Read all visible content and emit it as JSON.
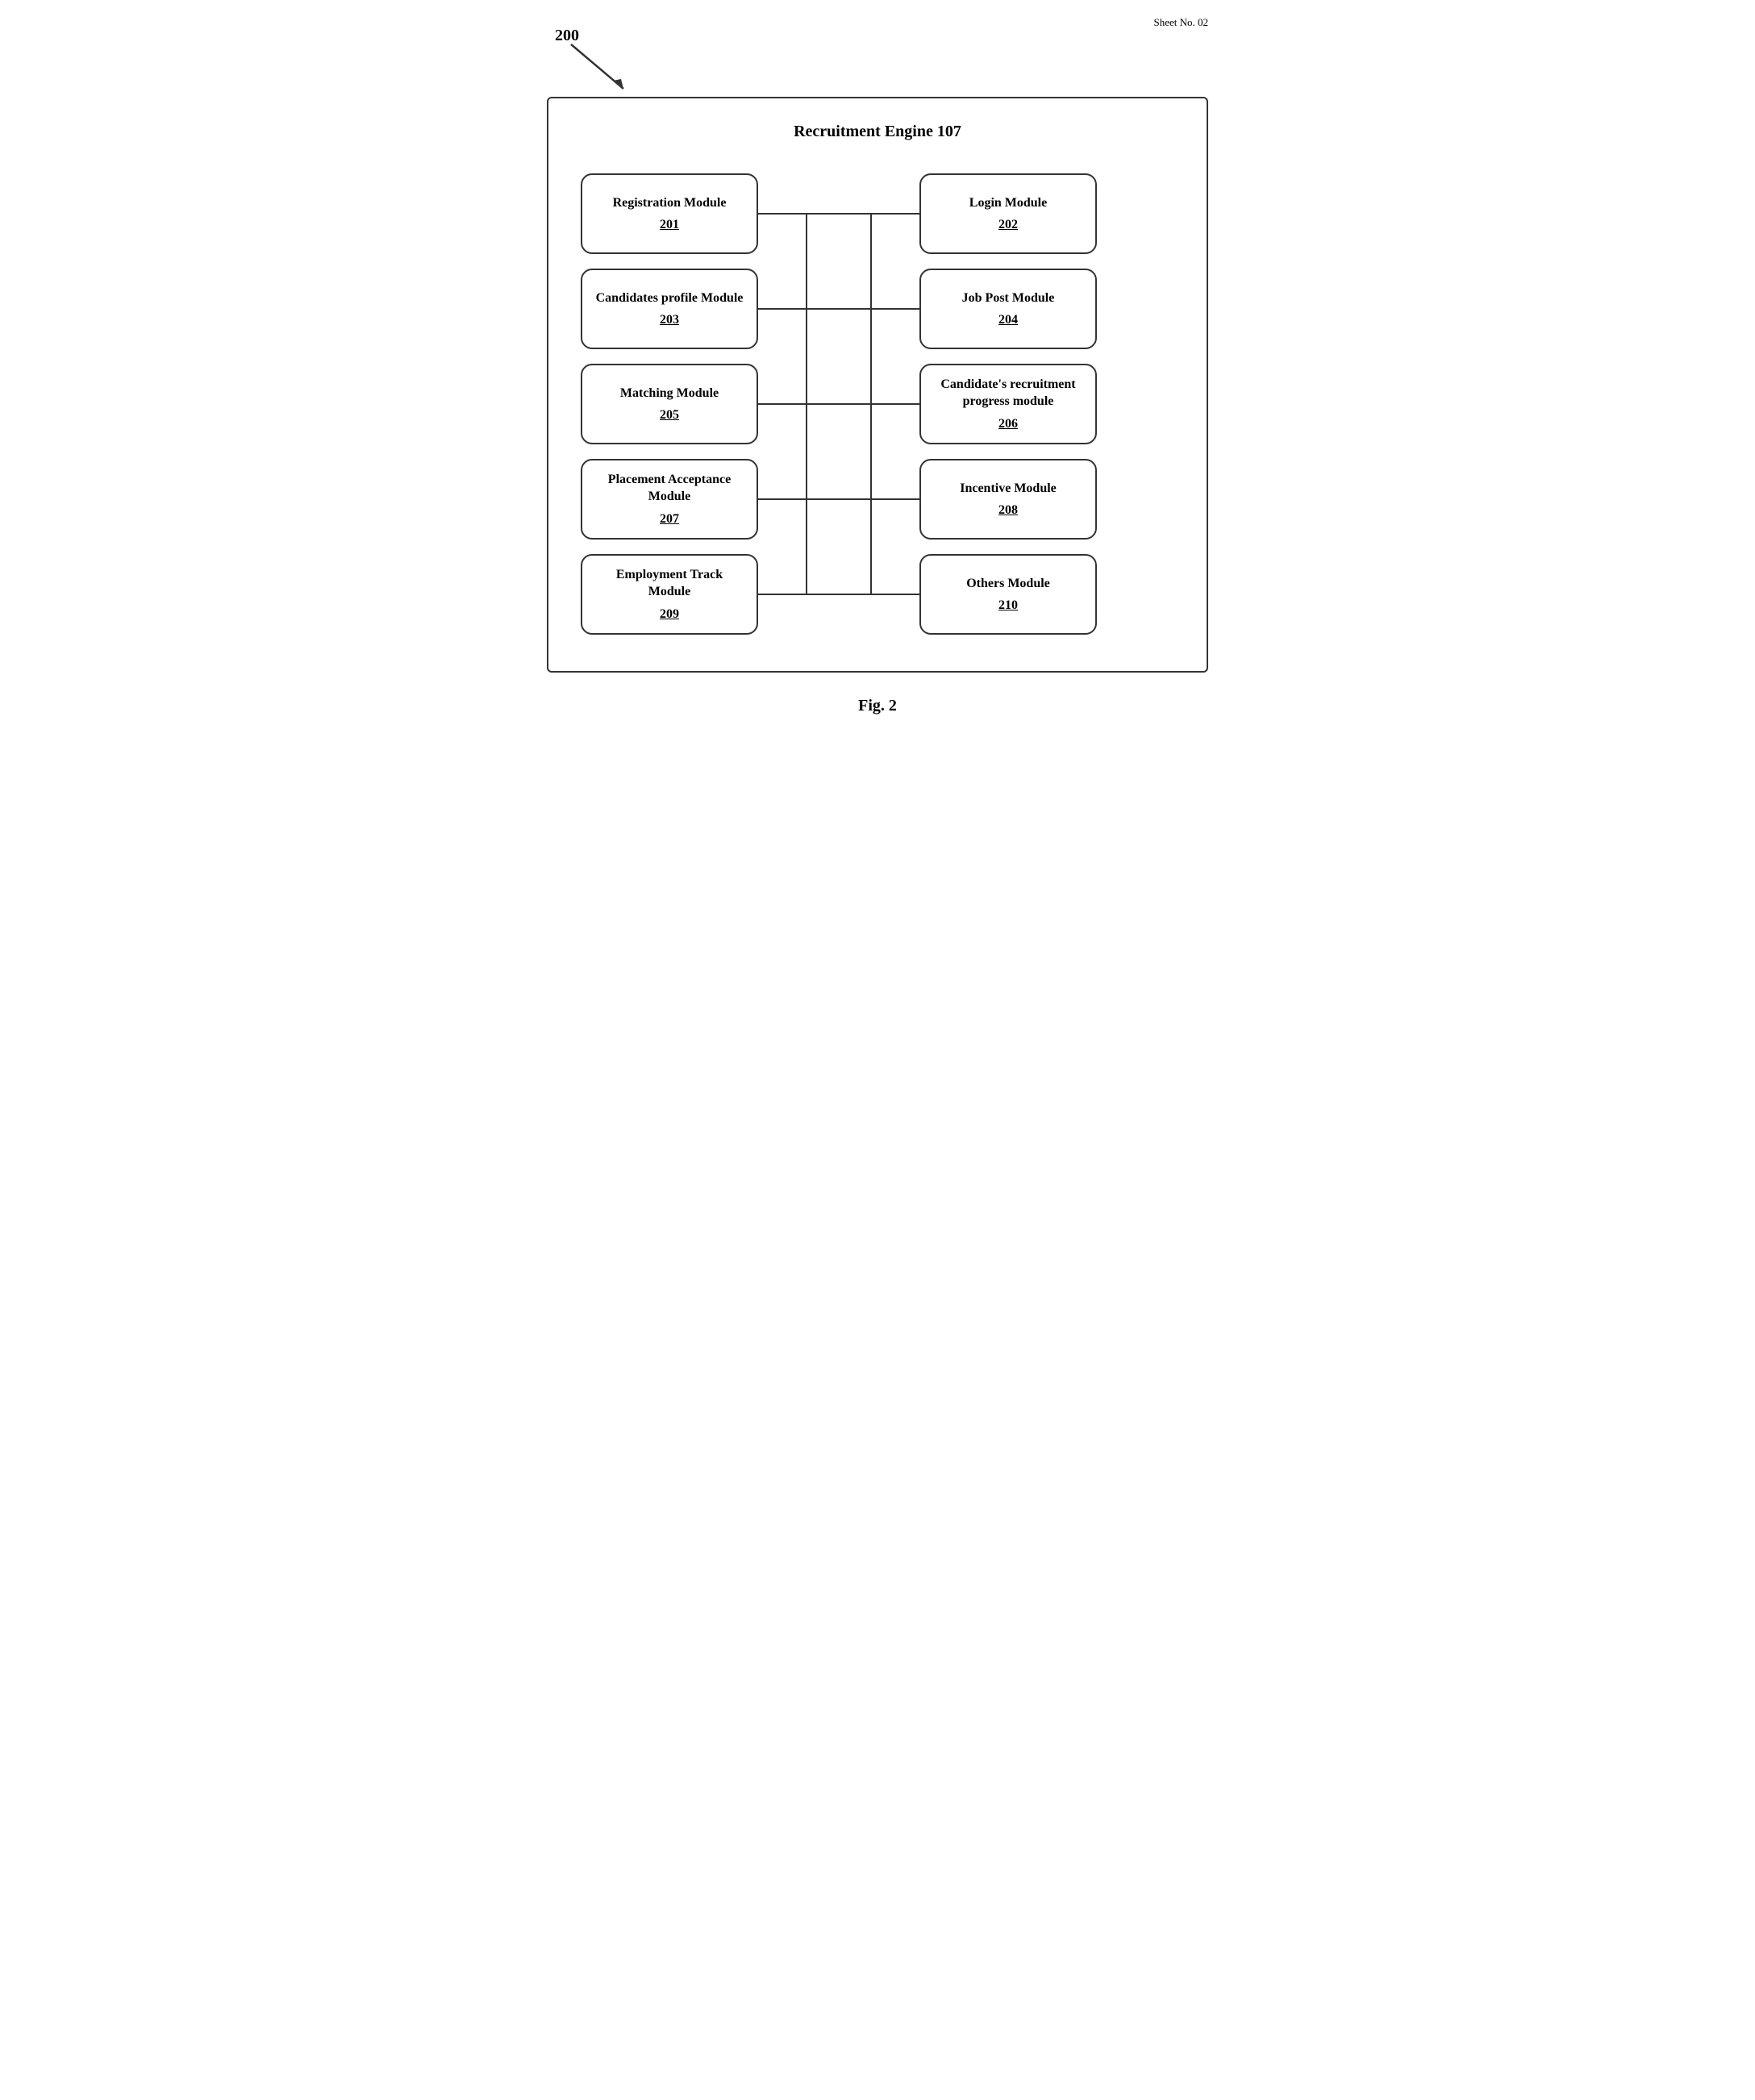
{
  "page": {
    "ref_number": "Sheet No. 02",
    "diagram_label": "200",
    "main_title": "Recruitment Engine 107",
    "fig_label": "Fig. 2",
    "left_modules": [
      {
        "name": "Registration Module",
        "num": "201"
      },
      {
        "name": "Candidates profile Module",
        "num": "203"
      },
      {
        "name": "Matching Module",
        "num": "205"
      },
      {
        "name": "Placement Acceptance Module",
        "num": "207"
      },
      {
        "name": "Employment Track Module",
        "num": "209"
      }
    ],
    "right_modules": [
      {
        "name": "Login Module",
        "num": "202"
      },
      {
        "name": "Job Post Module",
        "num": "204"
      },
      {
        "name": "Candidate's recruitment progress module",
        "num": "206"
      },
      {
        "name": "Incentive Module",
        "num": "208"
      },
      {
        "name": "Others Module",
        "num": "210"
      }
    ]
  }
}
